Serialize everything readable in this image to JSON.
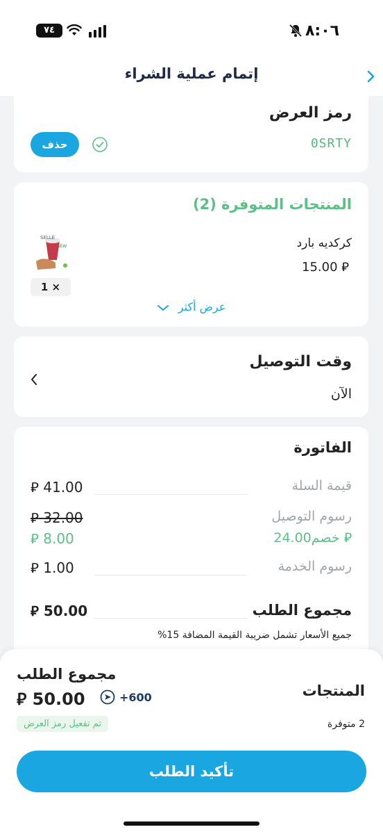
{
  "status_bar": {
    "time": "٨:٠٦",
    "battery": "٧٤"
  },
  "header": {
    "title": "إتمام عملية الشراء"
  },
  "promo": {
    "title": "رمز العرض",
    "code": "0SRTY",
    "delete_label": "حذف"
  },
  "products": {
    "title": "المنتجات المتوفرة (2)",
    "items": [
      {
        "name": "كركديه بارد",
        "price": "15.00",
        "qty": "1 ×"
      }
    ],
    "show_more_label": "عرض أكثر"
  },
  "delivery": {
    "title": "وقت التوصيل",
    "value": "الآن"
  },
  "invoice": {
    "title": "الفاتورة",
    "cart_label": "قيمة السلة",
    "cart_value": "41.00",
    "delivery_label": "رسوم التوصيل",
    "delivery_old_value": "32.00",
    "discount_label": "خصم24.00",
    "delivery_new_value": "8.00",
    "service_label": "رسوم الخدمة",
    "service_value": "1.00",
    "total_label": "مجموع الطلب",
    "total_value": "50.00",
    "vat_note": "جميع الأسعار تشمل ضريبة القيمة المضافة 15%"
  },
  "bottom": {
    "total_label": "مجموع الطلب",
    "total_value": "50.00",
    "points": "+600",
    "promo_applied": "تم تفعيل رمز العرض",
    "products_label": "المنتجات",
    "products_count": "2 متوفرة",
    "confirm_label": "تأكيد الطلب"
  },
  "colors": {
    "accent": "#1aa6e0",
    "success": "#5bbf86",
    "background": "#f2f3f5"
  }
}
